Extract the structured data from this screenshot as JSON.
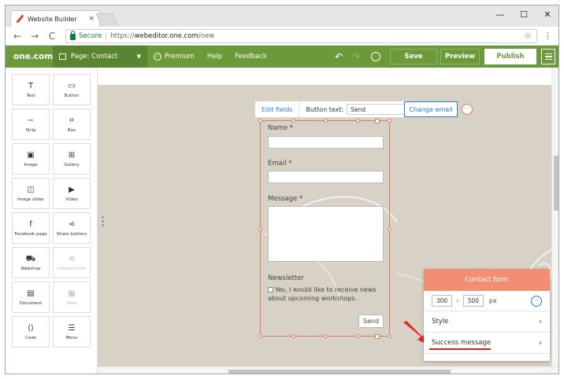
{
  "browser": {
    "tab_title": "Website Builder",
    "tab_close": "×",
    "secure_label": "Secure",
    "url_scheme": "https://",
    "url_host": "webeditor.one.com",
    "url_path": "/new",
    "back": "←",
    "forward": "→",
    "reload": "C",
    "star": "☆",
    "menu": "⋮",
    "minimize": "—",
    "maximize": "☐",
    "close": "✕"
  },
  "toolbar": {
    "logo": "one.com",
    "page_select": "Page: Contact",
    "premium": "Premium",
    "help": "Help",
    "feedback": "Feedback",
    "undo": "↶",
    "redo": "↷",
    "save": "Save",
    "preview": "Preview",
    "publish": "Publish",
    "accent_color": "#6c9a3a"
  },
  "tools": [
    {
      "label": "Text",
      "icon": "T",
      "enabled": true
    },
    {
      "label": "Button",
      "icon": "▭",
      "enabled": true
    },
    {
      "label": "Strip",
      "icon": "−",
      "enabled": true
    },
    {
      "label": "Box",
      "icon": "⌗",
      "enabled": true
    },
    {
      "label": "Image",
      "icon": "▣",
      "enabled": true
    },
    {
      "label": "Gallery",
      "icon": "⊞",
      "enabled": true
    },
    {
      "label": "Image slider",
      "icon": "◫",
      "enabled": true
    },
    {
      "label": "Video",
      "icon": "▶",
      "enabled": true
    },
    {
      "label": "Facebook page",
      "icon": "f",
      "enabled": true
    },
    {
      "label": "Share buttons",
      "icon": "⋖",
      "enabled": true
    },
    {
      "label": "Webshop",
      "icon": "⛟",
      "enabled": true
    },
    {
      "label": "Contact form",
      "icon": "≡",
      "enabled": false
    },
    {
      "label": "Document",
      "icon": "▤",
      "enabled": true
    },
    {
      "label": "Table",
      "icon": "▦",
      "enabled": false
    },
    {
      "label": "Code",
      "icon": "⟨⟩",
      "enabled": true
    },
    {
      "label": "Menu",
      "icon": "☰",
      "enabled": true
    }
  ],
  "form_toolbar": {
    "edit_fields": "Edit fields",
    "button_text_label": "Button text:",
    "button_text_value": "Send",
    "change_email": "Change email",
    "more": "···"
  },
  "form": {
    "name_label": "Name *",
    "email_label": "Email *",
    "message_label": "Message *",
    "newsletter_label": "Newsletter",
    "newsletter_option": "Yes, I would like to receive news about upcoming workshops.",
    "send": "Send"
  },
  "props": {
    "title": "Contact form",
    "width": "300",
    "times": "×",
    "height": "500",
    "unit": "px",
    "more": "···",
    "style": "Style",
    "success_message": "Success message",
    "chevron": "›",
    "header_color": "#f28e71"
  }
}
